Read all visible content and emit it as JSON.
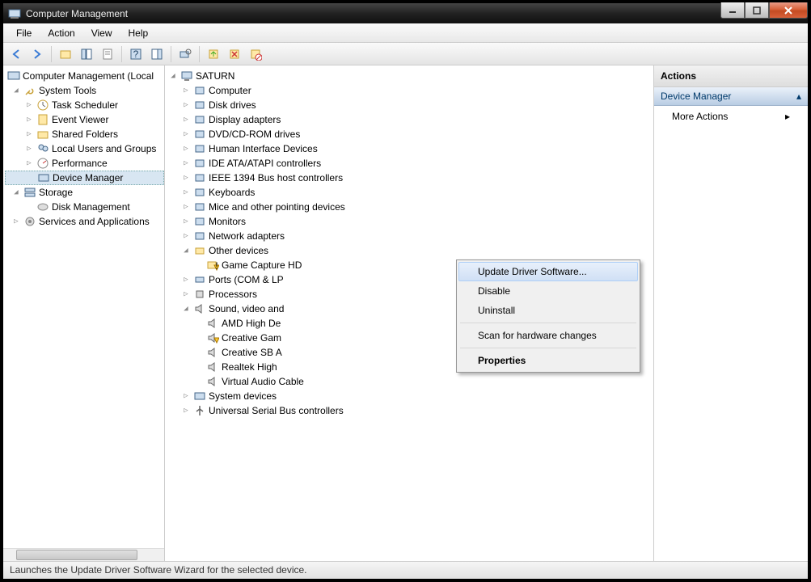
{
  "window": {
    "title": "Computer Management"
  },
  "menubar": [
    "File",
    "Action",
    "View",
    "Help"
  ],
  "left_tree": {
    "root": "Computer Management (Local",
    "system_tools": "System Tools",
    "st_items": [
      "Task Scheduler",
      "Event Viewer",
      "Shared Folders",
      "Local Users and Groups",
      "Performance",
      "Device Manager"
    ],
    "storage": "Storage",
    "storage_items": [
      "Disk Management"
    ],
    "services": "Services and Applications"
  },
  "device_tree": {
    "root": "SATURN",
    "cats": [
      "Computer",
      "Disk drives",
      "Display adapters",
      "DVD/CD-ROM drives",
      "Human Interface Devices",
      "IDE ATA/ATAPI controllers",
      "IEEE 1394 Bus host controllers",
      "Keyboards",
      "Mice and other pointing devices",
      "Monitors",
      "Network adapters"
    ],
    "other_devices": "Other devices",
    "other_item": "Game Capture HD",
    "ports": "Ports (COM & LP",
    "processors": "Processors",
    "sound": "Sound, video and",
    "sound_items": [
      "AMD High De",
      "Creative Gam",
      "Creative SB A",
      "Realtek High",
      "Virtual Audio Cable"
    ],
    "tail": [
      "System devices",
      "Universal Serial Bus controllers"
    ]
  },
  "context_menu": {
    "update": "Update Driver Software...",
    "disable": "Disable",
    "uninstall": "Uninstall",
    "scan": "Scan for hardware changes",
    "properties": "Properties"
  },
  "actions_pane": {
    "header": "Actions",
    "section": "Device Manager",
    "more": "More Actions"
  },
  "statusbar": "Launches the Update Driver Software Wizard for the selected device."
}
